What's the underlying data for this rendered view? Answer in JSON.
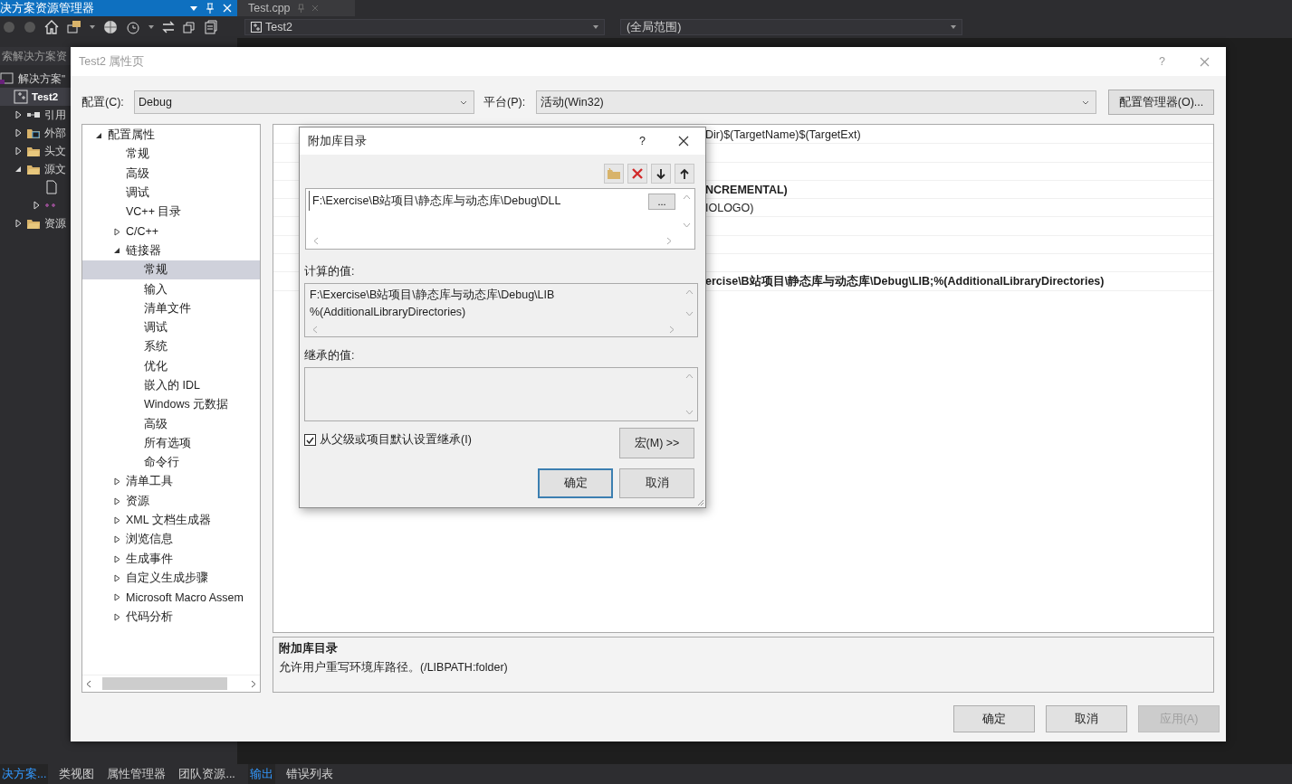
{
  "explorer": {
    "title": "决方案资源管理器",
    "search": {
      "placeholder": "索解决方案资"
    },
    "tree": [
      {
        "kind": "solution",
        "label": "解决方案\"",
        "selected": false,
        "children": [
          {
            "kind": "project",
            "label": "Test2",
            "selected": true,
            "children": [
              {
                "kind": "references",
                "label": "引用",
                "selected": false,
                "expanded": false
              },
              {
                "kind": "external",
                "label": "外部",
                "selected": false,
                "expanded": false
              },
              {
                "kind": "folder",
                "label": "头文",
                "selected": false,
                "expanded": false
              },
              {
                "kind": "folder",
                "label": "源文",
                "selected": false,
                "expanded": true,
                "children": [
                  {
                    "kind": "file",
                    "selected": false
                  },
                  {
                    "kind": "cpp",
                    "selected": false,
                    "expanded": false
                  }
                ]
              },
              {
                "kind": "folder",
                "label": "资源",
                "selected": false,
                "expanded": false
              }
            ]
          }
        ]
      }
    ]
  },
  "editor": {
    "tabs": [
      {
        "label": "Test.cpp",
        "selected": true
      }
    ],
    "project_combo": "Test2",
    "scope_combo": "(全局范围)"
  },
  "property_dialog": {
    "title": "Test2 属性页",
    "help": "?",
    "config_label": "配置(C):",
    "config": "Debug",
    "platform_label": "平台(P):",
    "platform": "活动(Win32)",
    "manager_button": "配置管理器(O)...",
    "tree": [
      {
        "kind": "group",
        "label": "配置属性",
        "selected": false,
        "expanded": true,
        "children": [
          {
            "kind": "item",
            "label": "常规",
            "selected": false
          },
          {
            "kind": "item",
            "label": "高级",
            "selected": false
          },
          {
            "kind": "item",
            "label": "调试",
            "selected": false
          },
          {
            "kind": "item",
            "label": "VC++ 目录",
            "selected": false
          },
          {
            "kind": "group",
            "label": "C/C++",
            "selected": false,
            "expanded": false
          },
          {
            "kind": "group",
            "label": "链接器",
            "selected": false,
            "expanded": true,
            "children": [
              {
                "kind": "item",
                "label": "常规",
                "selected": true
              },
              {
                "kind": "item",
                "label": "输入",
                "selected": false
              },
              {
                "kind": "item",
                "label": "清单文件",
                "selected": false
              },
              {
                "kind": "item",
                "label": "调试",
                "selected": false
              },
              {
                "kind": "item",
                "label": "系统",
                "selected": false
              },
              {
                "kind": "item",
                "label": "优化",
                "selected": false
              },
              {
                "kind": "item",
                "label": "嵌入的 IDL",
                "selected": false
              },
              {
                "kind": "item",
                "label": "Windows 元数据",
                "selected": false
              },
              {
                "kind": "item",
                "label": "高级",
                "selected": false
              },
              {
                "kind": "item",
                "label": "所有选项",
                "selected": false
              },
              {
                "kind": "item",
                "label": "命令行",
                "selected": false
              }
            ]
          },
          {
            "kind": "group",
            "label": "清单工具",
            "selected": false,
            "expanded": false
          },
          {
            "kind": "group",
            "label": "资源",
            "selected": false,
            "expanded": false
          },
          {
            "kind": "group",
            "label": "XML 文档生成器",
            "selected": false,
            "expanded": false
          },
          {
            "kind": "group",
            "label": "浏览信息",
            "selected": false,
            "expanded": false
          },
          {
            "kind": "group",
            "label": "生成事件",
            "selected": false,
            "expanded": false
          },
          {
            "kind": "group",
            "label": "自定义生成步骤",
            "selected": false,
            "expanded": false
          },
          {
            "kind": "group",
            "label": "Microsoft Macro Assem",
            "selected": false,
            "expanded": false
          },
          {
            "kind": "group",
            "label": "代码分析",
            "selected": false,
            "expanded": false
          }
        ]
      }
    ],
    "property_rows": [
      {
        "kind": "value",
        "value": "Dir)$(TargetName)$(TargetExt)",
        "modified": false
      },
      {
        "kind": "blank"
      },
      {
        "kind": "blank"
      },
      {
        "kind": "value",
        "value": "NCREMENTAL)",
        "modified": true
      },
      {
        "kind": "value",
        "value": "IOLOGO)",
        "modified": false
      },
      {
        "kind": "blank"
      },
      {
        "kind": "blank"
      },
      {
        "kind": "blank"
      },
      {
        "kind": "value",
        "value": "ercise\\B站项目\\静态库与动态库\\Debug\\LIB;%(AdditionalLibraryDirectories)",
        "modified": true
      }
    ],
    "description": {
      "title": "附加库目录",
      "text": "允许用户重写环境库路径。(/LIBPATH:folder)"
    },
    "buttons": [
      {
        "label": "确定",
        "disabled": false
      },
      {
        "label": "取消",
        "disabled": false
      },
      {
        "label": "应用(A)",
        "disabled": true
      }
    ]
  },
  "library_dialog": {
    "title": "附加库目录",
    "help": "?",
    "entries": [
      {
        "value": "F:\\Exercise\\B站项目\\静态库与动态库\\Debug\\DLL"
      }
    ],
    "browse_button": "...",
    "evaluated_label": "计算的值:",
    "evaluated_lines": [
      "F:\\Exercise\\B站项目\\静态库与动态库\\Debug\\LIB",
      "%(AdditionalLibraryDirectories)"
    ],
    "inherited_label": "继承的值:",
    "inherit": {
      "label": "从父级或项目默认设置继承(I)",
      "checked": true
    },
    "macros_button": "宏(M) >>",
    "buttons": [
      {
        "label": "确定",
        "focused": true
      },
      {
        "label": "取消",
        "focused": false
      }
    ]
  },
  "bottom_tabs": {
    "left": [
      {
        "label": "决方案...",
        "selected": true
      },
      {
        "label": "类视图",
        "selected": false
      },
      {
        "label": "属性管理器",
        "selected": false
      },
      {
        "label": "团队资源...",
        "selected": false
      }
    ],
    "right": [
      {
        "label": "输出",
        "selected": true
      },
      {
        "label": "错误列表",
        "selected": false
      }
    ]
  }
}
